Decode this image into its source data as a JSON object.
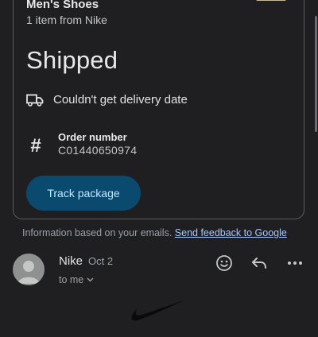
{
  "card": {
    "product_title": "Men's Shoes",
    "product_subtitle": "1 item from Nike",
    "status": "Shipped",
    "delivery_text": "Couldn't get delivery date",
    "order_label": "Order number",
    "order_number": "C01440650974",
    "track_button": "Track package",
    "icons": [
      "truck-icon",
      "hash-icon"
    ]
  },
  "footer": {
    "note": "Information based on your emails.",
    "feedback_link": "Send feedback to Google"
  },
  "message": {
    "sender": "Nike",
    "date": "Oct 2",
    "recipient": "to me",
    "icons": [
      "emoji-icon",
      "reply-icon",
      "more-icon",
      "chevron-down-icon"
    ]
  },
  "colors": {
    "background": "#1f1f21",
    "button_bg": "#0b4a6f",
    "button_text": "#c2e7ff",
    "link": "#a8c7fa"
  }
}
